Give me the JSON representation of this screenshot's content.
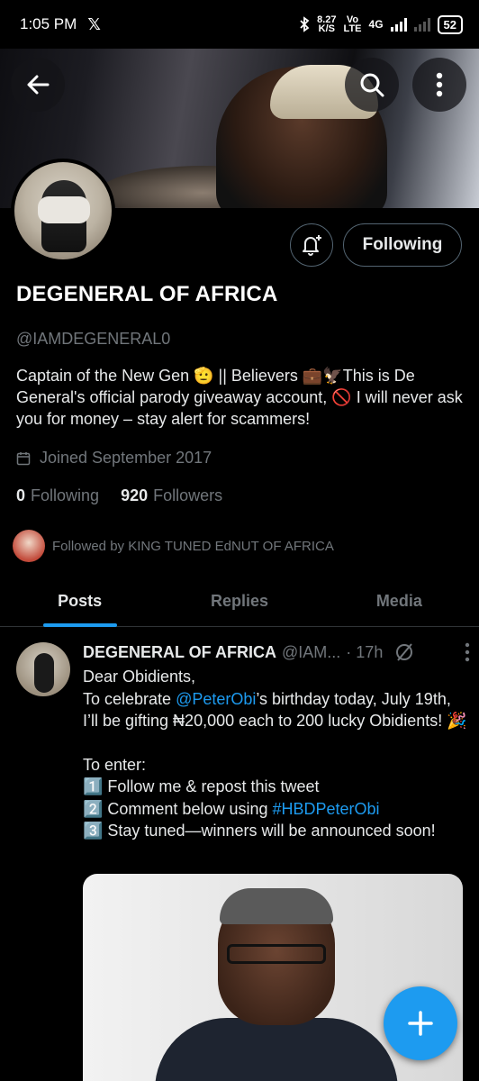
{
  "status_bar": {
    "time": "1:05 PM",
    "app_glyph": "𝕏",
    "speed_value": "8.27",
    "speed_unit": "K/S",
    "volte_top": "Vo",
    "volte_bottom": "LTE",
    "network": "4G",
    "battery": "52"
  },
  "profile": {
    "name": "DEGENERAL OF AFRICA",
    "handle": "@IAMDEGENERAL0",
    "bio": "Captain of the New Gen 🫡 || Believers 💼🦅This is De General's official parody giveaway account, 🚫 I will never ask you for money – stay alert for scammers!",
    "joined": "Joined September 2017",
    "following_count": "0",
    "following_label": "Following",
    "followers_count": "920",
    "followers_label": "Followers",
    "followed_by": "Followed by KING TUNED EdNUT OF AFRICA",
    "follow_button_label": "Following"
  },
  "tabs": [
    "Posts",
    "Replies",
    "Media"
  ],
  "active_tab": "Posts",
  "tweet": {
    "name": "DEGENERAL OF AFRICA",
    "handle": "@IAM...",
    "time": "· 17h",
    "line1": "Dear Obidients,",
    "line2_pre": "To celebrate ",
    "mention": "@PeterObi",
    "line2_post": "’s birthday today, July 19th, I’ll be gifting ₦20,000 each to 200 lucky Obidients! 🎉",
    "to_enter": "To enter:",
    "step1": "1️⃣ Follow me & repost this tweet",
    "step2_pre": "2️⃣ Comment below using ",
    "hashtag": "#HBDPeterObi",
    "step3": "3️⃣ Stay tuned—winners will be announced soon!"
  },
  "icons": {
    "back": "back-arrow-icon",
    "search": "search-icon",
    "more": "more-vertical-icon",
    "bell": "notification-bell-plus-icon",
    "calendar": "calendar-icon",
    "compose": "plus-icon"
  },
  "colors": {
    "accent": "#1d9bf0",
    "secondary_text": "#71767b",
    "background": "#000000"
  }
}
